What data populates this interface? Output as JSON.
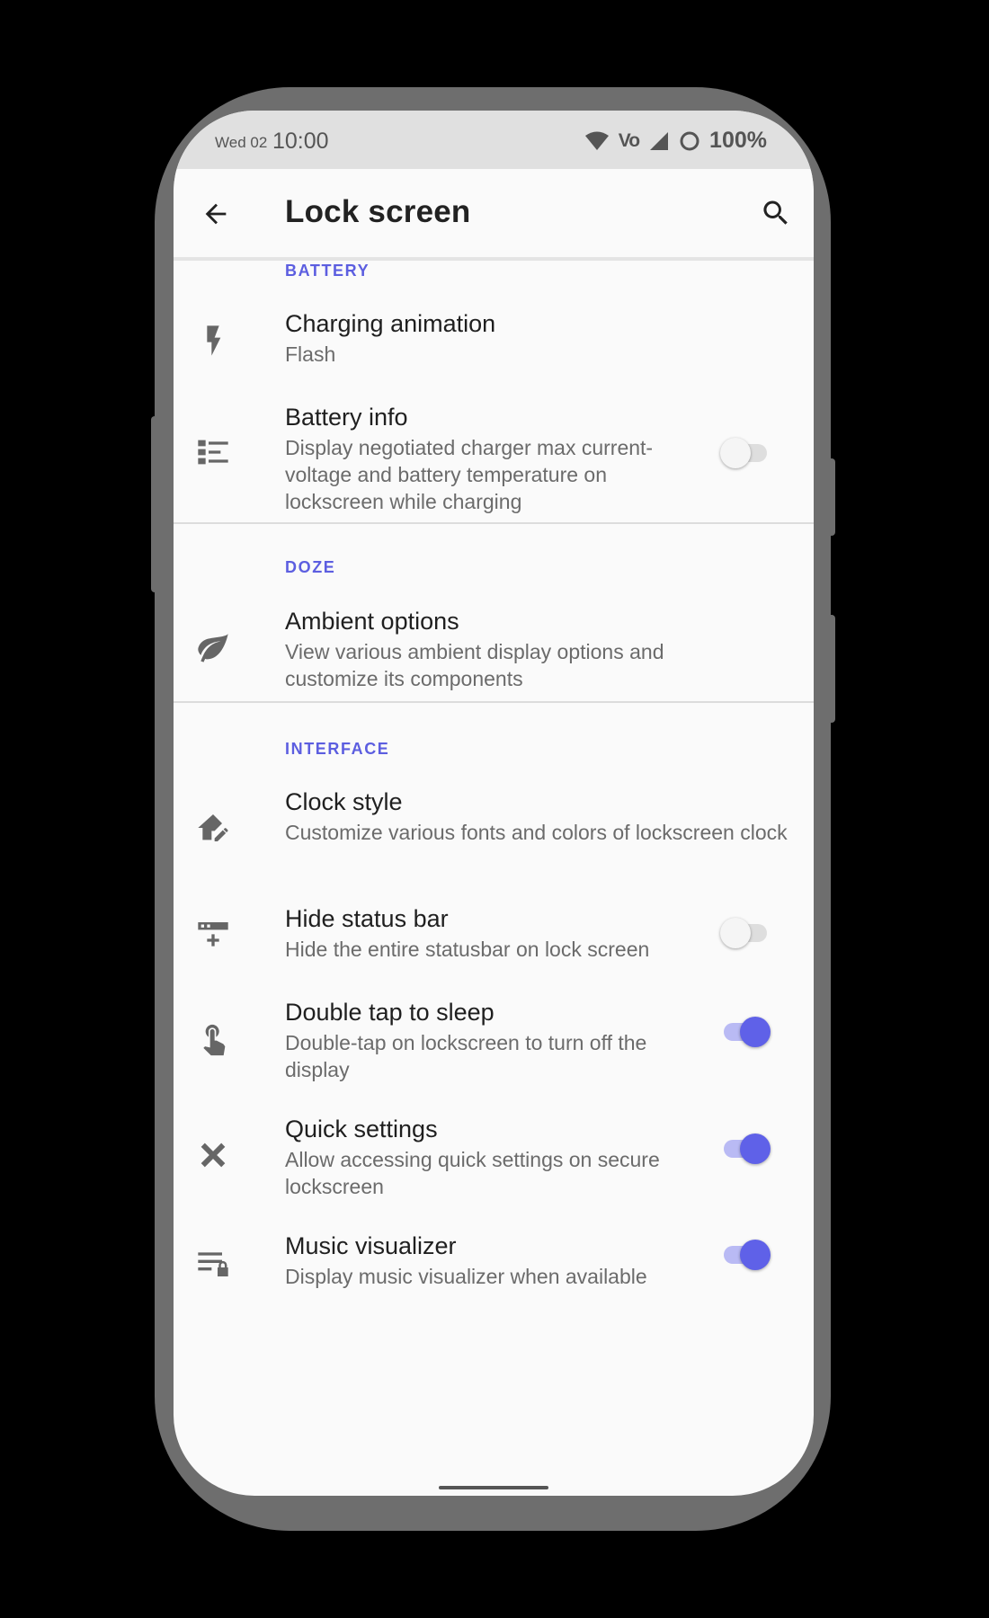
{
  "status_bar": {
    "date": "Wed 02",
    "time": "10:00",
    "network": "Vo",
    "battery": "100%"
  },
  "toolbar": {
    "title": "Lock screen"
  },
  "sections": [
    {
      "header": "BATTERY"
    },
    {
      "header": "DOZE"
    },
    {
      "header": "INTERFACE"
    }
  ],
  "items": [
    {
      "title": "Charging animation",
      "summary": "Flash",
      "icon": "flash-icon"
    },
    {
      "title": "Battery info",
      "summary": "Display negotiated charger max current-voltage and battery temperature on lockscreen while charging",
      "icon": "list-icon",
      "toggle": false
    },
    {
      "title": "Ambient options",
      "summary": "View various ambient display options and customize its components",
      "icon": "leaf-icon"
    },
    {
      "title": "Clock style",
      "summary": "Customize various fonts and colors of lockscreen clock",
      "icon": "home-edit-icon"
    },
    {
      "title": "Hide status bar",
      "summary": "Hide the entire statusbar on lock screen",
      "icon": "status-bar-icon",
      "toggle": false
    },
    {
      "title": "Double tap to sleep",
      "summary": "Double-tap on lockscreen to turn off the display",
      "icon": "touch-icon",
      "toggle": true
    },
    {
      "title": "Quick settings",
      "summary": "Allow accessing quick settings on secure lockscreen",
      "icon": "tools-icon",
      "toggle": true
    },
    {
      "title": "Music visualizer",
      "summary": "Display music visualizer when available",
      "icon": "playlist-lock-icon",
      "toggle": true
    }
  ],
  "colors": {
    "accent": "#5c5ee0",
    "toggle_on": "#5f61e8",
    "toggle_track_on": "#b9baf4",
    "statusbar_bg": "#e0e0e0",
    "background": "#fafafa"
  }
}
